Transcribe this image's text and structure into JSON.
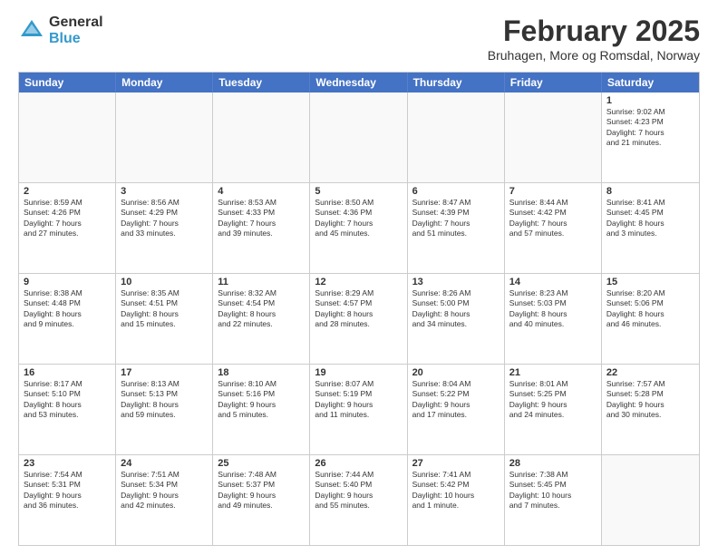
{
  "logo": {
    "general": "General",
    "blue": "Blue"
  },
  "title": "February 2025",
  "subtitle": "Bruhagen, More og Romsdal, Norway",
  "header_days": [
    "Sunday",
    "Monday",
    "Tuesday",
    "Wednesday",
    "Thursday",
    "Friday",
    "Saturday"
  ],
  "weeks": [
    [
      {
        "day": "",
        "info": "",
        "empty": true
      },
      {
        "day": "",
        "info": "",
        "empty": true
      },
      {
        "day": "",
        "info": "",
        "empty": true
      },
      {
        "day": "",
        "info": "",
        "empty": true
      },
      {
        "day": "",
        "info": "",
        "empty": true
      },
      {
        "day": "",
        "info": "",
        "empty": true
      },
      {
        "day": "1",
        "info": "Sunrise: 9:02 AM\nSunset: 4:23 PM\nDaylight: 7 hours\nand 21 minutes."
      }
    ],
    [
      {
        "day": "2",
        "info": "Sunrise: 8:59 AM\nSunset: 4:26 PM\nDaylight: 7 hours\nand 27 minutes."
      },
      {
        "day": "3",
        "info": "Sunrise: 8:56 AM\nSunset: 4:29 PM\nDaylight: 7 hours\nand 33 minutes."
      },
      {
        "day": "4",
        "info": "Sunrise: 8:53 AM\nSunset: 4:33 PM\nDaylight: 7 hours\nand 39 minutes."
      },
      {
        "day": "5",
        "info": "Sunrise: 8:50 AM\nSunset: 4:36 PM\nDaylight: 7 hours\nand 45 minutes."
      },
      {
        "day": "6",
        "info": "Sunrise: 8:47 AM\nSunset: 4:39 PM\nDaylight: 7 hours\nand 51 minutes."
      },
      {
        "day": "7",
        "info": "Sunrise: 8:44 AM\nSunset: 4:42 PM\nDaylight: 7 hours\nand 57 minutes."
      },
      {
        "day": "8",
        "info": "Sunrise: 8:41 AM\nSunset: 4:45 PM\nDaylight: 8 hours\nand 3 minutes."
      }
    ],
    [
      {
        "day": "9",
        "info": "Sunrise: 8:38 AM\nSunset: 4:48 PM\nDaylight: 8 hours\nand 9 minutes."
      },
      {
        "day": "10",
        "info": "Sunrise: 8:35 AM\nSunset: 4:51 PM\nDaylight: 8 hours\nand 15 minutes."
      },
      {
        "day": "11",
        "info": "Sunrise: 8:32 AM\nSunset: 4:54 PM\nDaylight: 8 hours\nand 22 minutes."
      },
      {
        "day": "12",
        "info": "Sunrise: 8:29 AM\nSunset: 4:57 PM\nDaylight: 8 hours\nand 28 minutes."
      },
      {
        "day": "13",
        "info": "Sunrise: 8:26 AM\nSunset: 5:00 PM\nDaylight: 8 hours\nand 34 minutes."
      },
      {
        "day": "14",
        "info": "Sunrise: 8:23 AM\nSunset: 5:03 PM\nDaylight: 8 hours\nand 40 minutes."
      },
      {
        "day": "15",
        "info": "Sunrise: 8:20 AM\nSunset: 5:06 PM\nDaylight: 8 hours\nand 46 minutes."
      }
    ],
    [
      {
        "day": "16",
        "info": "Sunrise: 8:17 AM\nSunset: 5:10 PM\nDaylight: 8 hours\nand 53 minutes."
      },
      {
        "day": "17",
        "info": "Sunrise: 8:13 AM\nSunset: 5:13 PM\nDaylight: 8 hours\nand 59 minutes."
      },
      {
        "day": "18",
        "info": "Sunrise: 8:10 AM\nSunset: 5:16 PM\nDaylight: 9 hours\nand 5 minutes."
      },
      {
        "day": "19",
        "info": "Sunrise: 8:07 AM\nSunset: 5:19 PM\nDaylight: 9 hours\nand 11 minutes."
      },
      {
        "day": "20",
        "info": "Sunrise: 8:04 AM\nSunset: 5:22 PM\nDaylight: 9 hours\nand 17 minutes."
      },
      {
        "day": "21",
        "info": "Sunrise: 8:01 AM\nSunset: 5:25 PM\nDaylight: 9 hours\nand 24 minutes."
      },
      {
        "day": "22",
        "info": "Sunrise: 7:57 AM\nSunset: 5:28 PM\nDaylight: 9 hours\nand 30 minutes."
      }
    ],
    [
      {
        "day": "23",
        "info": "Sunrise: 7:54 AM\nSunset: 5:31 PM\nDaylight: 9 hours\nand 36 minutes."
      },
      {
        "day": "24",
        "info": "Sunrise: 7:51 AM\nSunset: 5:34 PM\nDaylight: 9 hours\nand 42 minutes."
      },
      {
        "day": "25",
        "info": "Sunrise: 7:48 AM\nSunset: 5:37 PM\nDaylight: 9 hours\nand 49 minutes."
      },
      {
        "day": "26",
        "info": "Sunrise: 7:44 AM\nSunset: 5:40 PM\nDaylight: 9 hours\nand 55 minutes."
      },
      {
        "day": "27",
        "info": "Sunrise: 7:41 AM\nSunset: 5:42 PM\nDaylight: 10 hours\nand 1 minute."
      },
      {
        "day": "28",
        "info": "Sunrise: 7:38 AM\nSunset: 5:45 PM\nDaylight: 10 hours\nand 7 minutes."
      },
      {
        "day": "",
        "info": "",
        "empty": true
      }
    ]
  ]
}
